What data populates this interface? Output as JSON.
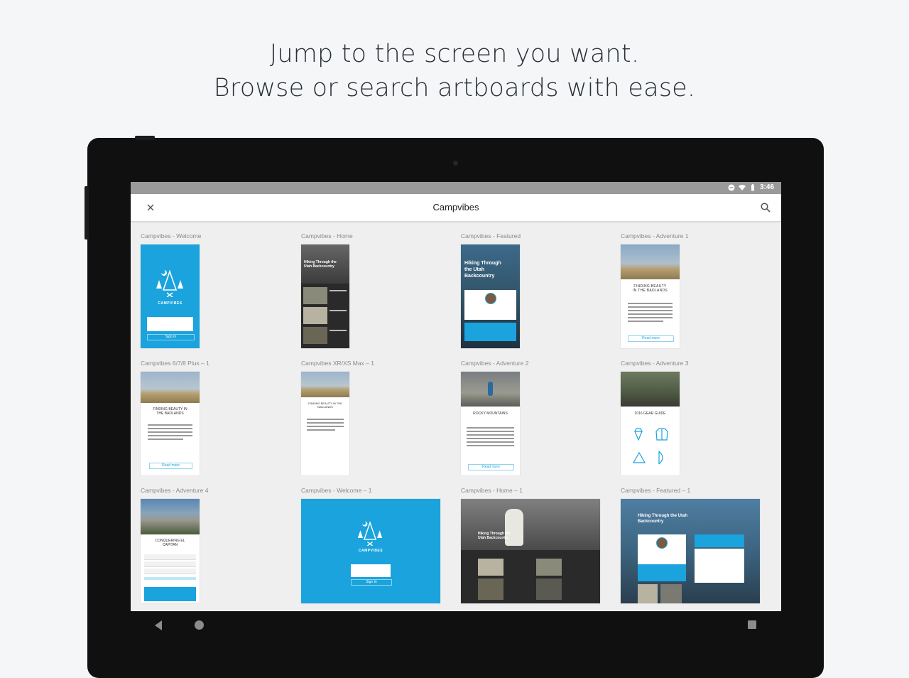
{
  "headline": {
    "line1": "Jump to the screen you want.",
    "line2": "Browse or search artboards with ease."
  },
  "status": {
    "time": "3:46"
  },
  "appbar": {
    "title": "Campvibes",
    "close_icon": "close-icon",
    "search_icon": "search-icon"
  },
  "artboards": [
    {
      "label": "Campvibes - Welcome"
    },
    {
      "label": "Campvibes - Home"
    },
    {
      "label": "Campvibes - Featured"
    },
    {
      "label": "Campvibes - Adventure 1"
    },
    {
      "label": "Campvibes 6/7/8 Plus – 1"
    },
    {
      "label": "Campvibes XR/XS Max – 1"
    },
    {
      "label": "Campvibes - Adventure 2"
    },
    {
      "label": "Campvibes - Adventure 3"
    },
    {
      "label": "Campvibes - Adventure 4"
    },
    {
      "label": "Campvibes - Welcome – 1"
    },
    {
      "label": "Campvibes - Home – 1"
    },
    {
      "label": "Campvibes - Featured – 1"
    }
  ],
  "thumb_text": {
    "brand": "CAMPVIBES",
    "hiking": "Hiking Through the Utah Backcountry",
    "finding": "FINDING BEAUTY IN THE BADLANDS",
    "rocky": "ROCKY MOUNTAINS",
    "gear": "2016 GEAR GUIDE",
    "conquering": "CONQUERING EL CAPITAN",
    "signin": "Sign In",
    "read_more": "Read more"
  },
  "colors": {
    "accent": "#1aa3dc",
    "dark": "#2a2a2a",
    "background": "#f4f6f8"
  },
  "navbar": {
    "back_icon": "back-triangle-icon",
    "home_icon": "home-circle-icon",
    "recents_icon": "recents-square-icon"
  }
}
